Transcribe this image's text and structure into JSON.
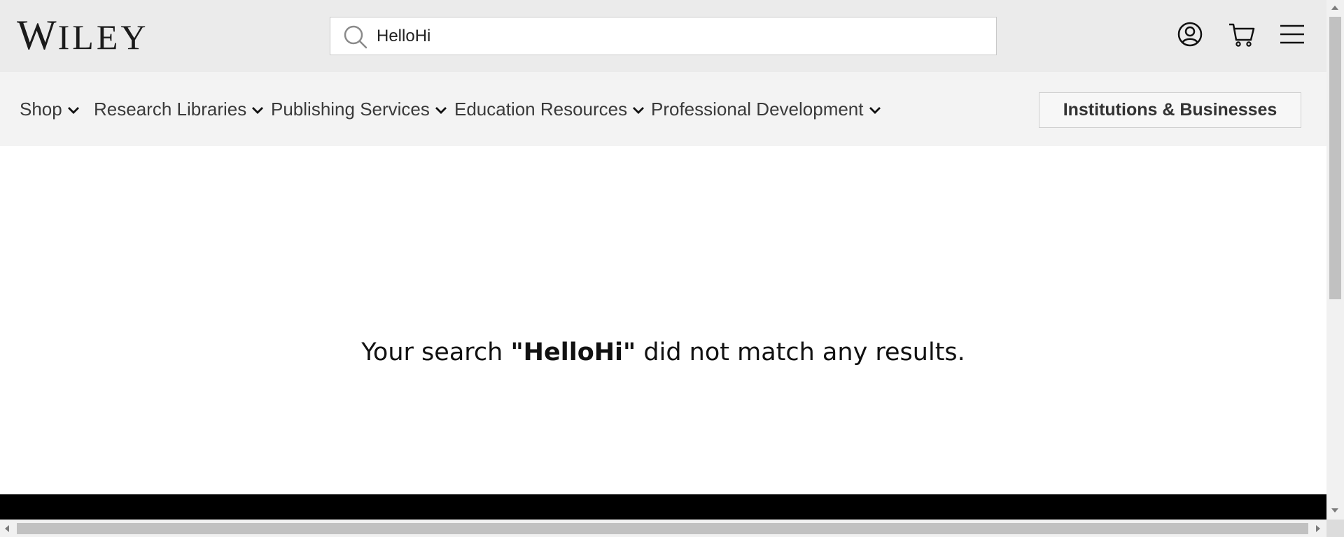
{
  "header": {
    "logo_first": "W",
    "logo_rest": "ILEY",
    "search": {
      "value": "HelloHi",
      "placeholder": ""
    },
    "icons": {
      "account": "account-icon",
      "cart": "cart-icon",
      "menu": "hamburger-menu-icon",
      "search": "search-icon"
    }
  },
  "nav": {
    "items": [
      {
        "label": "Shop"
      },
      {
        "label": "Research Libraries"
      },
      {
        "label": "Publishing Services"
      },
      {
        "label": "Education Resources"
      },
      {
        "label": "Professional Development"
      }
    ],
    "cta_label": "Institutions & Businesses"
  },
  "main": {
    "message_before": "Your search ",
    "query": "\"HelloHi\"",
    "message_after": " did not match any results."
  },
  "colors": {
    "header_bg": "#ebebeb",
    "nav_bg": "#f3f3f3",
    "footer_strip": "#000000"
  }
}
